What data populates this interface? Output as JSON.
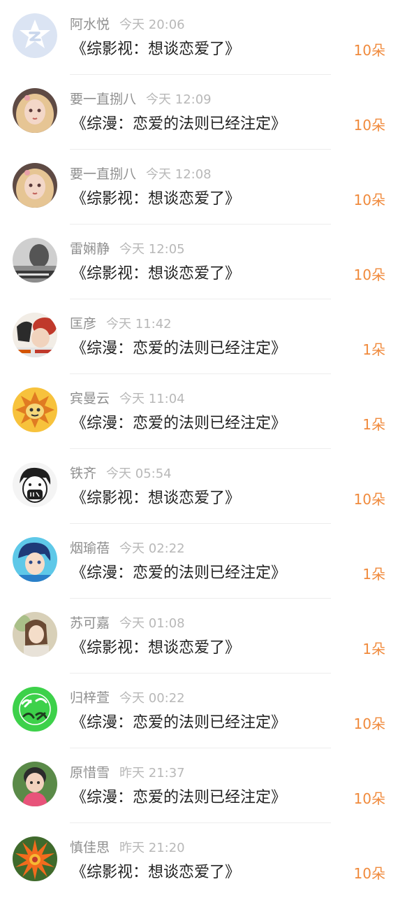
{
  "colors": {
    "name": "#8f8f8f",
    "time": "#b8b8b8",
    "title": "#222222",
    "count": "#f08a3c",
    "divider": "#ededed"
  },
  "gifts": [
    {
      "name": "阿水悦",
      "time": "今天 20:06",
      "title": "《综影视：想谈恋爱了》",
      "count": "10朵",
      "avatar": "default-avatar-icon"
    },
    {
      "name": "要一直捌八",
      "time": "今天 12:09",
      "title": "《综漫：恋爱的法则已经注定》",
      "count": "10朵",
      "avatar": "anime-girl-avatar"
    },
    {
      "name": "要一直捌八",
      "time": "今天 12:08",
      "title": "《综影视：想谈恋爱了》",
      "count": "10朵",
      "avatar": "anime-girl-avatar"
    },
    {
      "name": "雷娴静",
      "time": "今天 12:05",
      "title": "《综影视：想谈恋爱了》",
      "count": "10朵",
      "avatar": "gray-photo-avatar"
    },
    {
      "name": "匡彦",
      "time": "今天 11:42",
      "title": "《综漫：恋爱的法则已经注定》",
      "count": "1朵",
      "avatar": "red-hat-avatar"
    },
    {
      "name": "宾曼云",
      "time": "今天 11:04",
      "title": "《综漫：恋爱的法则已经注定》",
      "count": "1朵",
      "avatar": "orange-cartoon-avatar"
    },
    {
      "name": "铁齐",
      "time": "今天 05:54",
      "title": "《综影视：想谈恋爱了》",
      "count": "10朵",
      "avatar": "masked-boy-avatar"
    },
    {
      "name": "烟瑜蓓",
      "time": "今天 02:22",
      "title": "《综漫：恋爱的法则已经注定》",
      "count": "1朵",
      "avatar": "anime-boy-avatar"
    },
    {
      "name": "苏可嘉",
      "time": "今天 01:08",
      "title": "《综影视：想谈恋爱了》",
      "count": "1朵",
      "avatar": "girl-photo-avatar"
    },
    {
      "name": "归梓萱",
      "time": "今天 00:22",
      "title": "《综漫：恋爱的法则已经注定》",
      "count": "10朵",
      "avatar": "green-text-avatar"
    },
    {
      "name": "原惜雪",
      "time": "昨天 21:37",
      "title": "《综漫：恋爱的法则已经注定》",
      "count": "10朵",
      "avatar": "child-photo-avatar"
    },
    {
      "name": "慎佳思",
      "time": "昨天 21:20",
      "title": "《综影视：想谈恋爱了》",
      "count": "10朵",
      "avatar": "orange-flower-avatar"
    }
  ]
}
